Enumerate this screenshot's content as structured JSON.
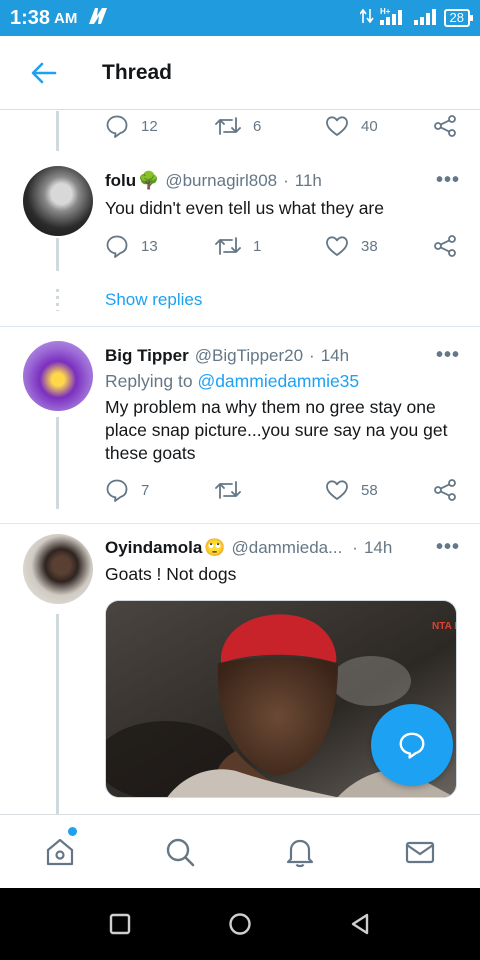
{
  "status_bar": {
    "time": "1:38",
    "ampm": "AM",
    "battery": "28",
    "network": "H+"
  },
  "header": {
    "title": "Thread"
  },
  "top_tweet_actions": {
    "replies": "12",
    "retweets": "6",
    "likes": "40"
  },
  "tweets": [
    {
      "name": "folu",
      "name_emoji": "🌳",
      "handle": "@burnagirl808",
      "time": "11h",
      "text": "You didn't even tell us what they are",
      "replies": "13",
      "retweets": "1",
      "likes": "38"
    },
    {
      "name": "Big Tipper",
      "handle": "@BigTipper20",
      "time": "14h",
      "replying_prefix": "Replying to",
      "replying_to": "@dammiedammie35",
      "text": "My problem na why them no gree stay one place snap picture...you sure say na you get these goats",
      "replies": "7",
      "retweets": "",
      "likes": "58"
    },
    {
      "name": "Oyindamola",
      "name_emoji": "🙄",
      "handle": "@dammieda...",
      "time": "14h",
      "text": "Goats ! Not dogs",
      "media_badge": "NTA LIVE"
    }
  ],
  "show_replies": "Show replies",
  "separator": "·",
  "more": "•••",
  "icons": {
    "back": "arrow-left-icon",
    "reply": "speech-bubble-icon",
    "retweet": "retweet-icon",
    "like": "heart-icon",
    "share": "share-icon",
    "fab": "compose-bubble-icon",
    "nav": [
      "home-icon",
      "search-icon",
      "bell-icon",
      "mail-icon"
    ]
  },
  "colors": {
    "accent": "#1da1f2",
    "status_bar": "#1f9bde",
    "muted": "#657786"
  }
}
